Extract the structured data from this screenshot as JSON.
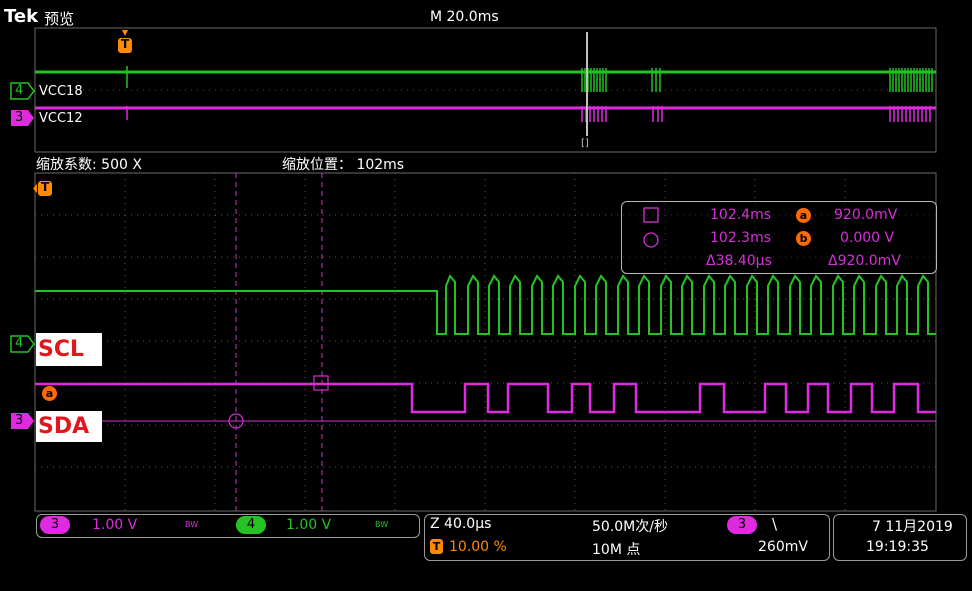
{
  "header": {
    "brand": "Tek",
    "mode": "预览",
    "timebase": "M 20.0ms"
  },
  "overview": {
    "trigger_marker": "T",
    "ch4_label": "VCC18",
    "ch3_label": "VCC12",
    "ch4_num": "4",
    "ch3_num": "3",
    "zoom_box_marker": "[]"
  },
  "zoom": {
    "factor_label": "缩放系数: 500 X",
    "position_label": "缩放位置： 102ms",
    "trigger_marker": "T"
  },
  "cursor_readout": {
    "cursor1_time": "102.4ms",
    "cursor2_time": "102.3ms",
    "delta_time": "Δ38.40μs",
    "cursor_a_label": "a",
    "cursor_b_label": "b",
    "cursor_a_volt": "920.0mV",
    "cursor_b_volt": "0.000 V",
    "delta_volt": "Δ920.0mV"
  },
  "channels": {
    "scl_label": "SCL",
    "sda_label": "SDA",
    "ch4_num": "4",
    "ch3_num": "3",
    "marker_a": "a"
  },
  "status": {
    "ch3_num": "3",
    "ch3_scale": "1.00 V",
    "ch3_bw": "BW",
    "ch4_num": "4",
    "ch4_scale": "1.00 V",
    "ch4_bw": "BW",
    "zoom_time": "Z 40.0μs",
    "sample_rate": "50.0M次/秒",
    "trigger_icon": "T",
    "trigger_pos": "10.00 %",
    "record_len": "10M 点",
    "trig_ch": "3",
    "trig_slope": "\\",
    "trig_level": "260mV",
    "date": "7 11月2019",
    "time": "19:19:35"
  },
  "colors": {
    "ch3": "#e02ae0",
    "ch4": "#22c322",
    "trigger": "#ff8a00",
    "grid": "#5a5a5a"
  }
}
